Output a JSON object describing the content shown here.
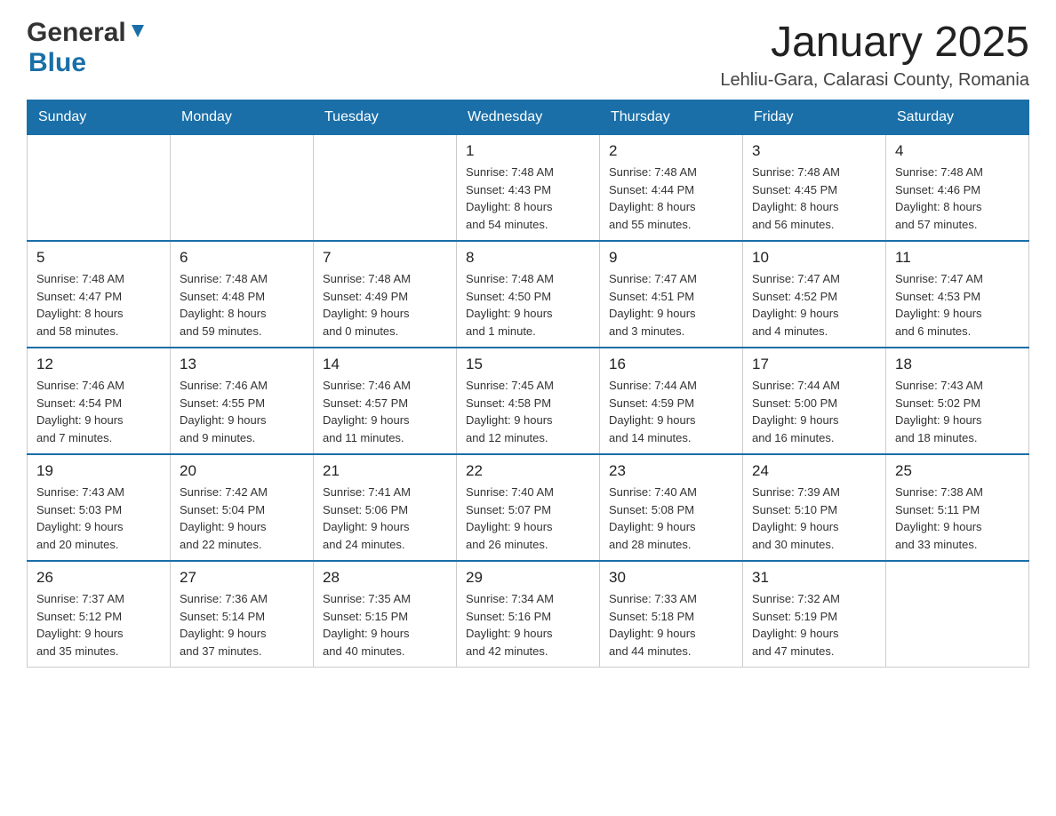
{
  "header": {
    "logo_general": "General",
    "logo_blue": "Blue",
    "month_title": "January 2025",
    "location": "Lehliu-Gara, Calarasi County, Romania"
  },
  "weekdays": [
    "Sunday",
    "Monday",
    "Tuesday",
    "Wednesday",
    "Thursday",
    "Friday",
    "Saturday"
  ],
  "weeks": [
    {
      "days": [
        {
          "number": "",
          "info": ""
        },
        {
          "number": "",
          "info": ""
        },
        {
          "number": "",
          "info": ""
        },
        {
          "number": "1",
          "info": "Sunrise: 7:48 AM\nSunset: 4:43 PM\nDaylight: 8 hours\nand 54 minutes."
        },
        {
          "number": "2",
          "info": "Sunrise: 7:48 AM\nSunset: 4:44 PM\nDaylight: 8 hours\nand 55 minutes."
        },
        {
          "number": "3",
          "info": "Sunrise: 7:48 AM\nSunset: 4:45 PM\nDaylight: 8 hours\nand 56 minutes."
        },
        {
          "number": "4",
          "info": "Sunrise: 7:48 AM\nSunset: 4:46 PM\nDaylight: 8 hours\nand 57 minutes."
        }
      ]
    },
    {
      "days": [
        {
          "number": "5",
          "info": "Sunrise: 7:48 AM\nSunset: 4:47 PM\nDaylight: 8 hours\nand 58 minutes."
        },
        {
          "number": "6",
          "info": "Sunrise: 7:48 AM\nSunset: 4:48 PM\nDaylight: 8 hours\nand 59 minutes."
        },
        {
          "number": "7",
          "info": "Sunrise: 7:48 AM\nSunset: 4:49 PM\nDaylight: 9 hours\nand 0 minutes."
        },
        {
          "number": "8",
          "info": "Sunrise: 7:48 AM\nSunset: 4:50 PM\nDaylight: 9 hours\nand 1 minute."
        },
        {
          "number": "9",
          "info": "Sunrise: 7:47 AM\nSunset: 4:51 PM\nDaylight: 9 hours\nand 3 minutes."
        },
        {
          "number": "10",
          "info": "Sunrise: 7:47 AM\nSunset: 4:52 PM\nDaylight: 9 hours\nand 4 minutes."
        },
        {
          "number": "11",
          "info": "Sunrise: 7:47 AM\nSunset: 4:53 PM\nDaylight: 9 hours\nand 6 minutes."
        }
      ]
    },
    {
      "days": [
        {
          "number": "12",
          "info": "Sunrise: 7:46 AM\nSunset: 4:54 PM\nDaylight: 9 hours\nand 7 minutes."
        },
        {
          "number": "13",
          "info": "Sunrise: 7:46 AM\nSunset: 4:55 PM\nDaylight: 9 hours\nand 9 minutes."
        },
        {
          "number": "14",
          "info": "Sunrise: 7:46 AM\nSunset: 4:57 PM\nDaylight: 9 hours\nand 11 minutes."
        },
        {
          "number": "15",
          "info": "Sunrise: 7:45 AM\nSunset: 4:58 PM\nDaylight: 9 hours\nand 12 minutes."
        },
        {
          "number": "16",
          "info": "Sunrise: 7:44 AM\nSunset: 4:59 PM\nDaylight: 9 hours\nand 14 minutes."
        },
        {
          "number": "17",
          "info": "Sunrise: 7:44 AM\nSunset: 5:00 PM\nDaylight: 9 hours\nand 16 minutes."
        },
        {
          "number": "18",
          "info": "Sunrise: 7:43 AM\nSunset: 5:02 PM\nDaylight: 9 hours\nand 18 minutes."
        }
      ]
    },
    {
      "days": [
        {
          "number": "19",
          "info": "Sunrise: 7:43 AM\nSunset: 5:03 PM\nDaylight: 9 hours\nand 20 minutes."
        },
        {
          "number": "20",
          "info": "Sunrise: 7:42 AM\nSunset: 5:04 PM\nDaylight: 9 hours\nand 22 minutes."
        },
        {
          "number": "21",
          "info": "Sunrise: 7:41 AM\nSunset: 5:06 PM\nDaylight: 9 hours\nand 24 minutes."
        },
        {
          "number": "22",
          "info": "Sunrise: 7:40 AM\nSunset: 5:07 PM\nDaylight: 9 hours\nand 26 minutes."
        },
        {
          "number": "23",
          "info": "Sunrise: 7:40 AM\nSunset: 5:08 PM\nDaylight: 9 hours\nand 28 minutes."
        },
        {
          "number": "24",
          "info": "Sunrise: 7:39 AM\nSunset: 5:10 PM\nDaylight: 9 hours\nand 30 minutes."
        },
        {
          "number": "25",
          "info": "Sunrise: 7:38 AM\nSunset: 5:11 PM\nDaylight: 9 hours\nand 33 minutes."
        }
      ]
    },
    {
      "days": [
        {
          "number": "26",
          "info": "Sunrise: 7:37 AM\nSunset: 5:12 PM\nDaylight: 9 hours\nand 35 minutes."
        },
        {
          "number": "27",
          "info": "Sunrise: 7:36 AM\nSunset: 5:14 PM\nDaylight: 9 hours\nand 37 minutes."
        },
        {
          "number": "28",
          "info": "Sunrise: 7:35 AM\nSunset: 5:15 PM\nDaylight: 9 hours\nand 40 minutes."
        },
        {
          "number": "29",
          "info": "Sunrise: 7:34 AM\nSunset: 5:16 PM\nDaylight: 9 hours\nand 42 minutes."
        },
        {
          "number": "30",
          "info": "Sunrise: 7:33 AM\nSunset: 5:18 PM\nDaylight: 9 hours\nand 44 minutes."
        },
        {
          "number": "31",
          "info": "Sunrise: 7:32 AM\nSunset: 5:19 PM\nDaylight: 9 hours\nand 47 minutes."
        },
        {
          "number": "",
          "info": ""
        }
      ]
    }
  ]
}
